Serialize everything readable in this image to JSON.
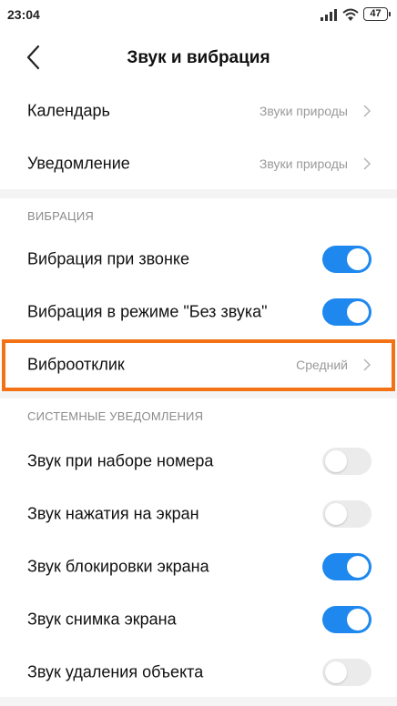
{
  "status_bar": {
    "time": "23:04",
    "battery": "47"
  },
  "header": {
    "title": "Звук и вибрация"
  },
  "sounds": [
    {
      "label": "Календарь",
      "value": "Звуки природы"
    },
    {
      "label": "Уведомление",
      "value": "Звуки природы"
    }
  ],
  "vibration": {
    "header": "ВИБРАЦИЯ",
    "items": [
      {
        "label": "Вибрация при звонке",
        "state": "on"
      },
      {
        "label": "Вибрация в режиме \"Без звука\"",
        "state": "on"
      }
    ],
    "feedback": {
      "label": "Виброотклик",
      "value": "Средний"
    }
  },
  "system": {
    "header": "СИСТЕМНЫЕ УВЕДОМЛЕНИЯ",
    "items": [
      {
        "label": "Звук при наборе номера",
        "state": "off"
      },
      {
        "label": "Звук нажатия на экран",
        "state": "off"
      },
      {
        "label": "Звук блокировки экрана",
        "state": "on"
      },
      {
        "label": "Звук снимка экрана",
        "state": "on"
      },
      {
        "label": "Звук удаления объекта",
        "state": "off"
      }
    ]
  },
  "colors": {
    "toggle_on": "#1e88ef",
    "toggle_off": "#ebebeb",
    "highlight": "#f37216"
  }
}
